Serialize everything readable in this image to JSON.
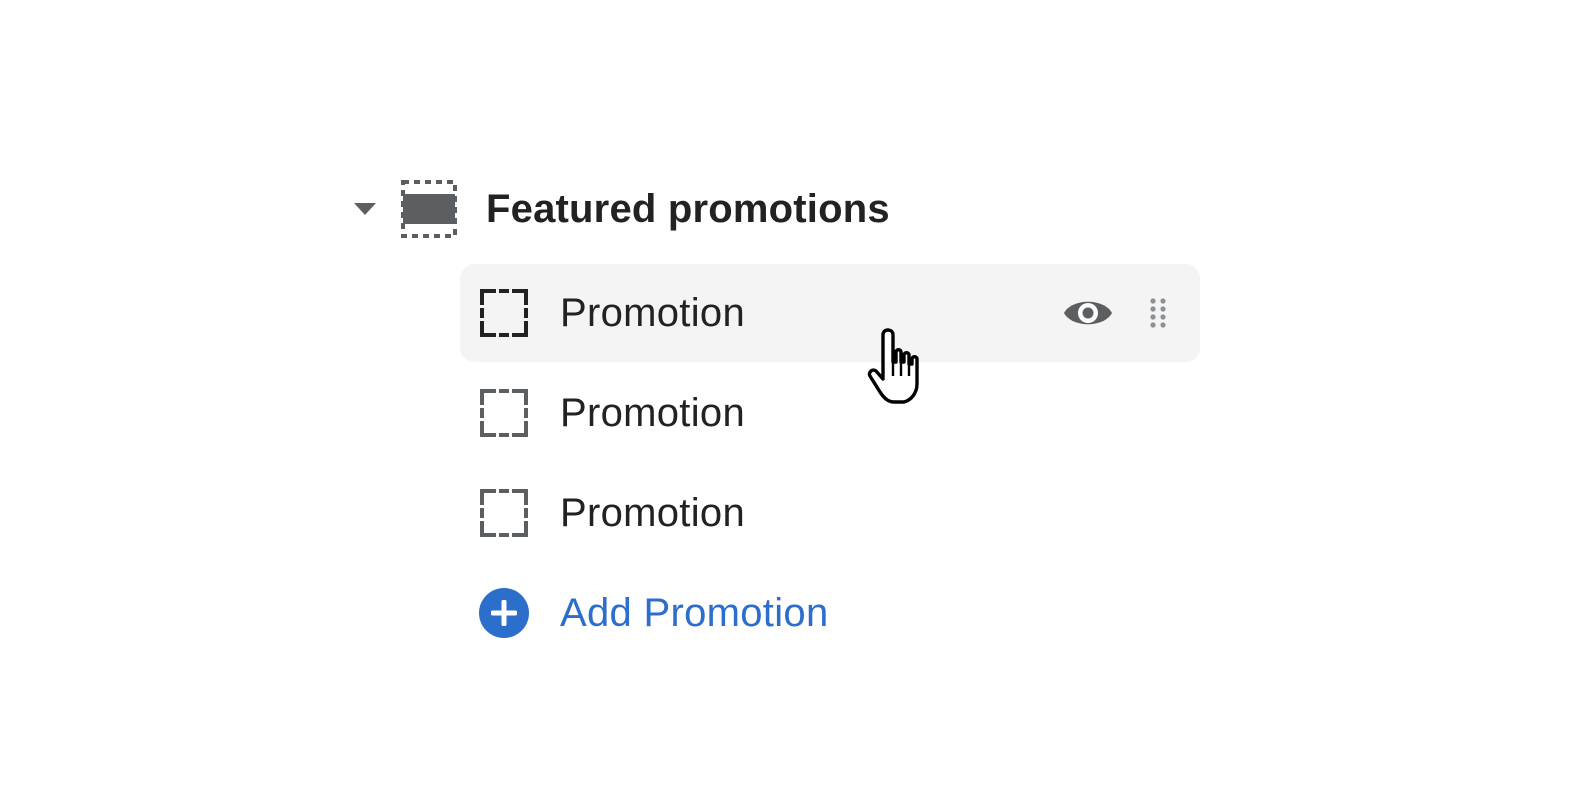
{
  "section": {
    "title": "Featured promotions",
    "expanded": true,
    "caret_icon": "caret-down-icon",
    "section_icon": "featured-section-icon"
  },
  "blocks": [
    {
      "label": "Promotion",
      "icon": "dashed-frame-icon",
      "hovered": true,
      "visible": true
    },
    {
      "label": "Promotion",
      "icon": "dashed-frame-icon",
      "hovered": false
    },
    {
      "label": "Promotion",
      "icon": "dashed-frame-icon",
      "hovered": false
    }
  ],
  "add_block": {
    "label": "Add Promotion",
    "icon": "plus-circle-icon"
  },
  "colors": {
    "text": "#202223",
    "muted_icon": "#5c5f62",
    "accent": "#2c6ecb",
    "hover_bg": "#f4f4f4"
  }
}
